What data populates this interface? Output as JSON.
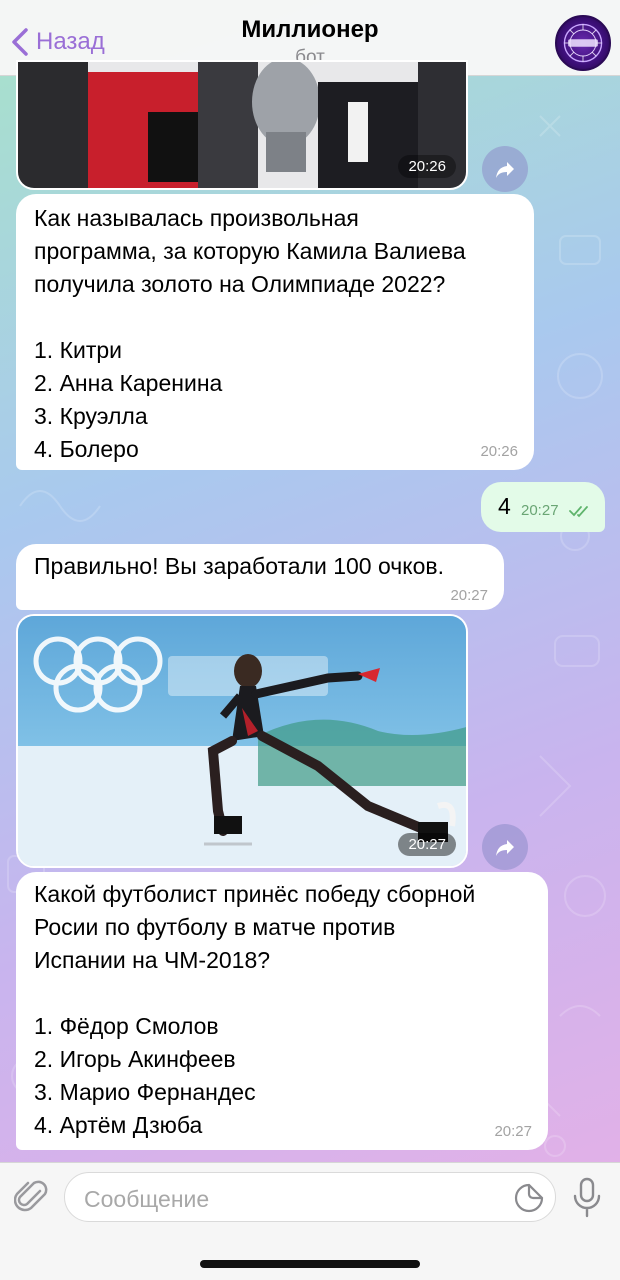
{
  "header": {
    "back_label": "Назад",
    "title": "Миллионер",
    "subtitle": "бот"
  },
  "messages": [
    {
      "kind": "photo",
      "time": "20:26"
    },
    {
      "kind": "text",
      "text": "Как называлась произвольная\nпрограмма, за которую Камила Валиева\nполучила золото на Олимпиаде 2022?\n\n1. Китри\n2. Анна Каренина\n3. Круэлла\n4. Болеро",
      "time": "20:26"
    },
    {
      "kind": "outgoing",
      "text": "4",
      "time": "20:27",
      "status": "read"
    },
    {
      "kind": "text",
      "text": "Правильно! Вы заработали 100 очков.",
      "time": "20:27"
    },
    {
      "kind": "photo",
      "time": "20:27"
    },
    {
      "kind": "text",
      "text": "Какой футболист принёс победу сборной\nРосии по футболу в матче против\nИспании на ЧМ-2018?\n\n1. Фёдор Смолов\n2. Игорь Акинфеев\n3. Марио Фернандес\n4. Артём Дзюба",
      "time": "20:27"
    }
  ],
  "input": {
    "placeholder": "Сообщение"
  },
  "icons": {
    "back": "chevron-left-icon",
    "share": "share-arrow-icon",
    "attach": "paperclip-icon",
    "sticker": "sticker-icon",
    "mic": "microphone-icon",
    "read": "double-check-icon"
  },
  "colors": {
    "accent": "#9a6fd6",
    "outgoing_bubble": "#e3fbe8",
    "incoming_bubble": "#ffffff",
    "read_check": "#5fb46c"
  }
}
